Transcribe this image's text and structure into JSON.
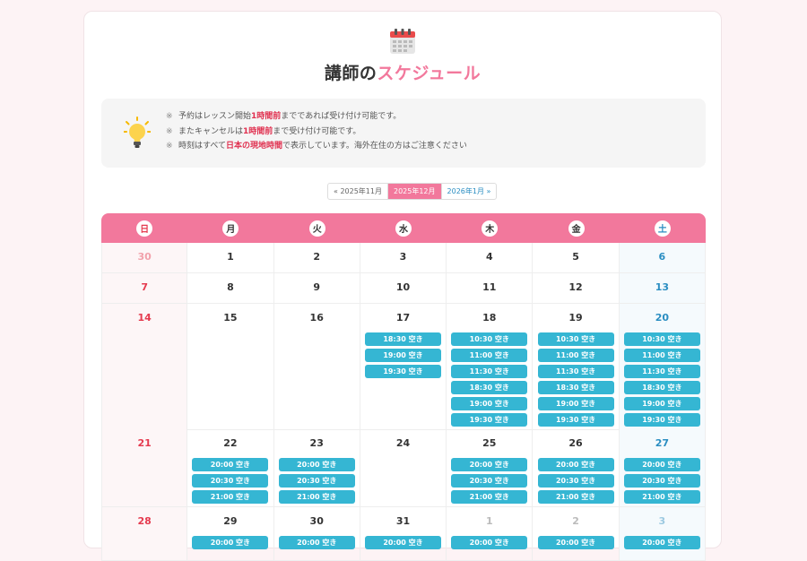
{
  "header": {
    "title_prefix": "講師の",
    "title_accent": "スケジュール"
  },
  "notice": {
    "icon": "lightbulb-icon",
    "items": [
      {
        "mark": "※",
        "before": "予約はレッスン開始",
        "bold": "1時間前",
        "after": "までであれば受け付け可能です。"
      },
      {
        "mark": "※",
        "before": "またキャンセルは",
        "bold": "1時間前",
        "after": "まで受け付け可能です。"
      },
      {
        "mark": "※",
        "before": "時刻はすべて",
        "bold": "日本の現地時間",
        "after": "で表示しています。海外在住の方はご注意ください"
      }
    ]
  },
  "month_nav": {
    "prev": "« 2025年11月",
    "current": "2025年12月",
    "next": "2026年1月 »"
  },
  "colors": {
    "accent": "#f2789c",
    "slot": "#35b6d3",
    "sunday": "#e53b4f",
    "saturday": "#2b8ec2"
  },
  "weekdays": [
    "日",
    "月",
    "火",
    "水",
    "木",
    "金",
    "土"
  ],
  "weeks": [
    [
      {
        "day": "30",
        "other": true,
        "slots": []
      },
      {
        "day": "1",
        "slots": []
      },
      {
        "day": "2",
        "slots": []
      },
      {
        "day": "3",
        "slots": []
      },
      {
        "day": "4",
        "slots": []
      },
      {
        "day": "5",
        "slots": []
      },
      {
        "day": "6",
        "slots": []
      }
    ],
    [
      {
        "day": "7",
        "slots": []
      },
      {
        "day": "8",
        "slots": []
      },
      {
        "day": "9",
        "slots": []
      },
      {
        "day": "10",
        "slots": []
      },
      {
        "day": "11",
        "slots": []
      },
      {
        "day": "12",
        "slots": []
      },
      {
        "day": "13",
        "slots": []
      }
    ],
    [
      {
        "day": "14",
        "slots": []
      },
      {
        "day": "15",
        "slots": []
      },
      {
        "day": "16",
        "slots": []
      },
      {
        "day": "17",
        "slots": [
          "18:30 空き",
          "19:00 空き",
          "19:30 空き"
        ]
      },
      {
        "day": "18",
        "slots": [
          "10:30 空き",
          "11:00 空き",
          "11:30 空き",
          "18:30 空き",
          "19:00 空き",
          "19:30 空き"
        ]
      },
      {
        "day": "19",
        "slots": [
          "10:30 空き",
          "11:00 空き",
          "11:30 空き",
          "18:30 空き",
          "19:00 空き",
          "19:30 空き"
        ]
      },
      {
        "day": "20",
        "slots": [
          "10:30 空き",
          "11:00 空き",
          "11:30 空き",
          "18:30 空き",
          "19:00 空き",
          "19:30 空き"
        ]
      }
    ],
    [
      {
        "day": "21",
        "slots": []
      },
      {
        "day": "22",
        "slots": [
          "20:00 空き",
          "20:30 空き",
          "21:00 空き"
        ]
      },
      {
        "day": "23",
        "slots": [
          "20:00 空き",
          "20:30 空き",
          "21:00 空き"
        ]
      },
      {
        "day": "24",
        "slots": []
      },
      {
        "day": "25",
        "slots": [
          "20:00 空き",
          "20:30 空き",
          "21:00 空き"
        ]
      },
      {
        "day": "26",
        "slots": [
          "20:00 空き",
          "20:30 空き",
          "21:00 空き"
        ]
      },
      {
        "day": "27",
        "slots": [
          "20:00 空き",
          "20:30 空き",
          "21:00 空き"
        ]
      }
    ],
    [
      {
        "day": "28",
        "slots": []
      },
      {
        "day": "29",
        "slots": [
          "20:00 空き"
        ]
      },
      {
        "day": "30",
        "slots": [
          "20:00 空き"
        ]
      },
      {
        "day": "31",
        "slots": [
          "20:00 空き"
        ]
      },
      {
        "day": "1",
        "other": true,
        "slots": [
          "20:00 空き"
        ]
      },
      {
        "day": "2",
        "other": true,
        "slots": [
          "20:00 空き"
        ]
      },
      {
        "day": "3",
        "other": true,
        "slots": [
          "20:00 空き"
        ]
      }
    ]
  ]
}
